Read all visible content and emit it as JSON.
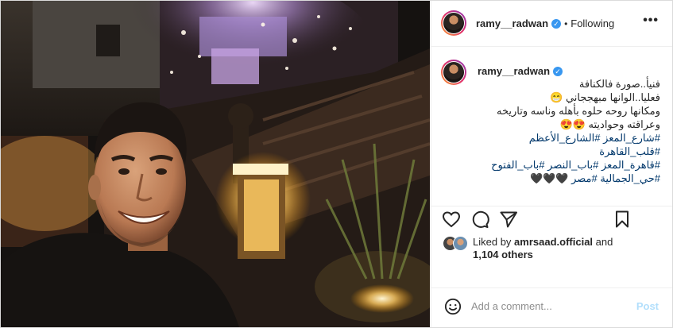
{
  "post": {
    "author": "ramy__radwan",
    "follow_status": "Following",
    "separator": "•",
    "verified_mark": "✓",
    "more_label": "•••",
    "caption_lines": [
      "فنيأ..صورة فالكنافة",
      "فعليا..الوانها مبهججاني 😁",
      "ومكانها روحه حلوه بأهله وناسه وتاريخه",
      "وعراقته وحواديته 😍😍"
    ],
    "hashtag_lines": [
      "#شارع_المعز #الشارع_الأعظم #قلب_القاهرة",
      "#قاهرة_المعز #باب_النصر #باب_الفتوح",
      "#حي_الجمالية #مصر 🖤🖤🖤"
    ]
  },
  "actions": {
    "like_icon": "heart-icon",
    "comment_icon": "comment-icon",
    "share_icon": "paper-plane-icon",
    "save_icon": "bookmark-icon"
  },
  "likes": {
    "liked_by_prefix": "Liked by",
    "liked_by_user": "amrsaad.official",
    "and_word": "and",
    "others": "1,104 others"
  },
  "comment": {
    "placeholder": "Add a comment...",
    "post_label": "Post",
    "emoji_icon": "smiley-icon"
  },
  "colors": {
    "accent": "#3897f0",
    "hashtag": "#00376b",
    "post_disabled": "#b2dffc",
    "border": "#dbdbdb"
  }
}
